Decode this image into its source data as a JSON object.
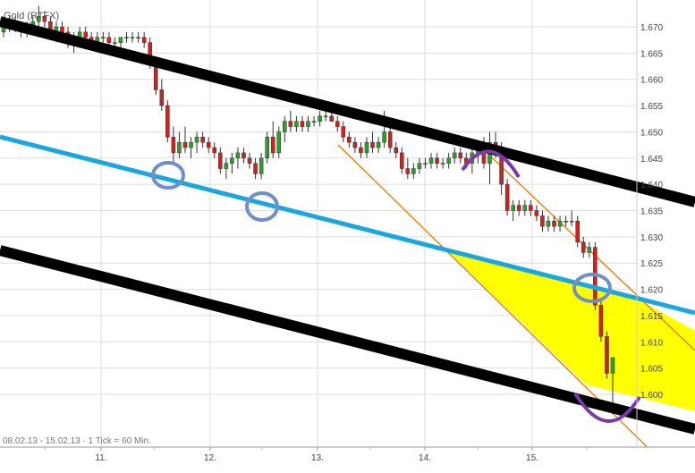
{
  "chart_data": {
    "type": "candlestick",
    "title": "Gold (RTFX)",
    "footer": "08.02.13 - 15.02.13 · 1 Tick = 60 Min.",
    "x_ticks": [
      "11.",
      "12.",
      "13.",
      "14.",
      "15."
    ],
    "y_ticks": [
      "1.670",
      "1.665",
      "1.660",
      "1.655",
      "1.650",
      "1.645",
      "1.640",
      "1.635",
      "1.630",
      "1.625",
      "1.620",
      "1.615",
      "1.610",
      "1.605",
      "1.600"
    ],
    "ylim": [
      1.595,
      1.674
    ],
    "grid": true,
    "colors": {
      "up": "#2e9e2e",
      "down": "#cc2222",
      "grid": "#dddddd",
      "channel": "#000000",
      "midline": "#1aa7e0",
      "trend": "#f07800",
      "fill": "#ffff00",
      "circle": "#6f8fc8",
      "arc": "#7a3aa8"
    },
    "series": [
      {
        "candles": [
          [
            1.669,
            1.671,
            1.668,
            1.67
          ],
          [
            1.67,
            1.672,
            1.669,
            1.671
          ],
          [
            1.671,
            1.672,
            1.669,
            1.67
          ],
          [
            1.67,
            1.671,
            1.668,
            1.669
          ],
          [
            1.669,
            1.671,
            1.668,
            1.67
          ],
          [
            1.67,
            1.672,
            1.669,
            1.671
          ],
          [
            1.671,
            1.674,
            1.67,
            1.672
          ],
          [
            1.672,
            1.673,
            1.67,
            1.671
          ],
          [
            1.671,
            1.672,
            1.668,
            1.669
          ],
          [
            1.669,
            1.671,
            1.667,
            1.67
          ],
          [
            1.67,
            1.671,
            1.668,
            1.669
          ],
          [
            1.669,
            1.67,
            1.666,
            1.667
          ],
          [
            1.667,
            1.669,
            1.665,
            1.668
          ],
          [
            1.668,
            1.67,
            1.666,
            1.669
          ],
          [
            1.669,
            1.67,
            1.667,
            1.668
          ],
          [
            1.668,
            1.669,
            1.666,
            1.667
          ],
          [
            1.667,
            1.669,
            1.666,
            1.668
          ],
          [
            1.668,
            1.669,
            1.667,
            1.668
          ],
          [
            1.668,
            1.669,
            1.666,
            1.667
          ],
          [
            1.667,
            1.668,
            1.666,
            1.667
          ],
          [
            1.667,
            1.668,
            1.665,
            1.668
          ],
          [
            1.668,
            1.669,
            1.667,
            1.668
          ],
          [
            1.668,
            1.669,
            1.667,
            1.668
          ],
          [
            1.668,
            1.669,
            1.667,
            1.668
          ],
          [
            1.668,
            1.669,
            1.666,
            1.667
          ],
          [
            1.667,
            1.668,
            1.662,
            1.663
          ],
          [
            1.663,
            1.664,
            1.657,
            1.658
          ],
          [
            1.658,
            1.66,
            1.654,
            1.655
          ],
          [
            1.655,
            1.656,
            1.648,
            1.649
          ],
          [
            1.649,
            1.651,
            1.644,
            1.646
          ],
          [
            1.646,
            1.65,
            1.645,
            1.648
          ],
          [
            1.648,
            1.651,
            1.646,
            1.647
          ],
          [
            1.647,
            1.649,
            1.645,
            1.648
          ],
          [
            1.648,
            1.65,
            1.646,
            1.649
          ],
          [
            1.649,
            1.65,
            1.647,
            1.648
          ],
          [
            1.648,
            1.649,
            1.646,
            1.647
          ],
          [
            1.647,
            1.648,
            1.645,
            1.646
          ],
          [
            1.646,
            1.647,
            1.642,
            1.643
          ],
          [
            1.643,
            1.645,
            1.641,
            1.644
          ],
          [
            1.644,
            1.646,
            1.642,
            1.645
          ],
          [
            1.645,
            1.647,
            1.643,
            1.646
          ],
          [
            1.646,
            1.647,
            1.644,
            1.645
          ],
          [
            1.645,
            1.646,
            1.643,
            1.644
          ],
          [
            1.644,
            1.645,
            1.641,
            1.642
          ],
          [
            1.642,
            1.646,
            1.641,
            1.645
          ],
          [
            1.645,
            1.65,
            1.644,
            1.649
          ],
          [
            1.649,
            1.652,
            1.645,
            1.646
          ],
          [
            1.646,
            1.651,
            1.645,
            1.65
          ],
          [
            1.65,
            1.653,
            1.648,
            1.652
          ],
          [
            1.652,
            1.654,
            1.65,
            1.651
          ],
          [
            1.651,
            1.653,
            1.65,
            1.652
          ],
          [
            1.652,
            1.653,
            1.65,
            1.651
          ],
          [
            1.651,
            1.653,
            1.65,
            1.652
          ],
          [
            1.652,
            1.653,
            1.651,
            1.652
          ],
          [
            1.652,
            1.654,
            1.651,
            1.653
          ],
          [
            1.653,
            1.654,
            1.652,
            1.653
          ],
          [
            1.653,
            1.654,
            1.652,
            1.652
          ],
          [
            1.652,
            1.653,
            1.65,
            1.651
          ],
          [
            1.651,
            1.652,
            1.648,
            1.649
          ],
          [
            1.649,
            1.65,
            1.647,
            1.648
          ],
          [
            1.648,
            1.649,
            1.646,
            1.647
          ],
          [
            1.647,
            1.648,
            1.645,
            1.646
          ],
          [
            1.646,
            1.649,
            1.645,
            1.648
          ],
          [
            1.648,
            1.65,
            1.646,
            1.647
          ],
          [
            1.647,
            1.649,
            1.646,
            1.648
          ],
          [
            1.648,
            1.654,
            1.647,
            1.65
          ],
          [
            1.65,
            1.652,
            1.646,
            1.647
          ],
          [
            1.647,
            1.648,
            1.645,
            1.646
          ],
          [
            1.646,
            1.647,
            1.642,
            1.643
          ],
          [
            1.643,
            1.645,
            1.641,
            1.642
          ],
          [
            1.642,
            1.644,
            1.641,
            1.643
          ],
          [
            1.643,
            1.645,
            1.642,
            1.644
          ],
          [
            1.644,
            1.645,
            1.643,
            1.644
          ],
          [
            1.644,
            1.646,
            1.643,
            1.645
          ],
          [
            1.645,
            1.646,
            1.643,
            1.644
          ],
          [
            1.644,
            1.645,
            1.643,
            1.644
          ],
          [
            1.644,
            1.646,
            1.643,
            1.645
          ],
          [
            1.645,
            1.647,
            1.644,
            1.646
          ],
          [
            1.646,
            1.647,
            1.644,
            1.645
          ],
          [
            1.645,
            1.646,
            1.643,
            1.644
          ],
          [
            1.644,
            1.647,
            1.642,
            1.646
          ],
          [
            1.646,
            1.648,
            1.644,
            1.647
          ],
          [
            1.647,
            1.649,
            1.643,
            1.644
          ],
          [
            1.644,
            1.65,
            1.64,
            1.648
          ],
          [
            1.648,
            1.65,
            1.645,
            1.646
          ],
          [
            1.646,
            1.648,
            1.638,
            1.64
          ],
          [
            1.64,
            1.641,
            1.634,
            1.635
          ],
          [
            1.635,
            1.637,
            1.633,
            1.636
          ],
          [
            1.636,
            1.637,
            1.634,
            1.635
          ],
          [
            1.635,
            1.637,
            1.634,
            1.636
          ],
          [
            1.636,
            1.637,
            1.634,
            1.635
          ],
          [
            1.635,
            1.636,
            1.633,
            1.634
          ],
          [
            1.634,
            1.635,
            1.631,
            1.632
          ],
          [
            1.632,
            1.634,
            1.631,
            1.633
          ],
          [
            1.633,
            1.634,
            1.631,
            1.632
          ],
          [
            1.632,
            1.634,
            1.631,
            1.633
          ],
          [
            1.633,
            1.634,
            1.632,
            1.633
          ],
          [
            1.633,
            1.635,
            1.632,
            1.633
          ],
          [
            1.633,
            1.634,
            1.628,
            1.629
          ],
          [
            1.629,
            1.63,
            1.626,
            1.627
          ],
          [
            1.627,
            1.629,
            1.626,
            1.628
          ],
          [
            1.628,
            1.629,
            1.616,
            1.617
          ],
          [
            1.617,
            1.618,
            1.61,
            1.611
          ],
          [
            1.611,
            1.612,
            1.603,
            1.604
          ],
          [
            1.604,
            1.606,
            1.597,
            1.607
          ]
        ]
      }
    ]
  }
}
